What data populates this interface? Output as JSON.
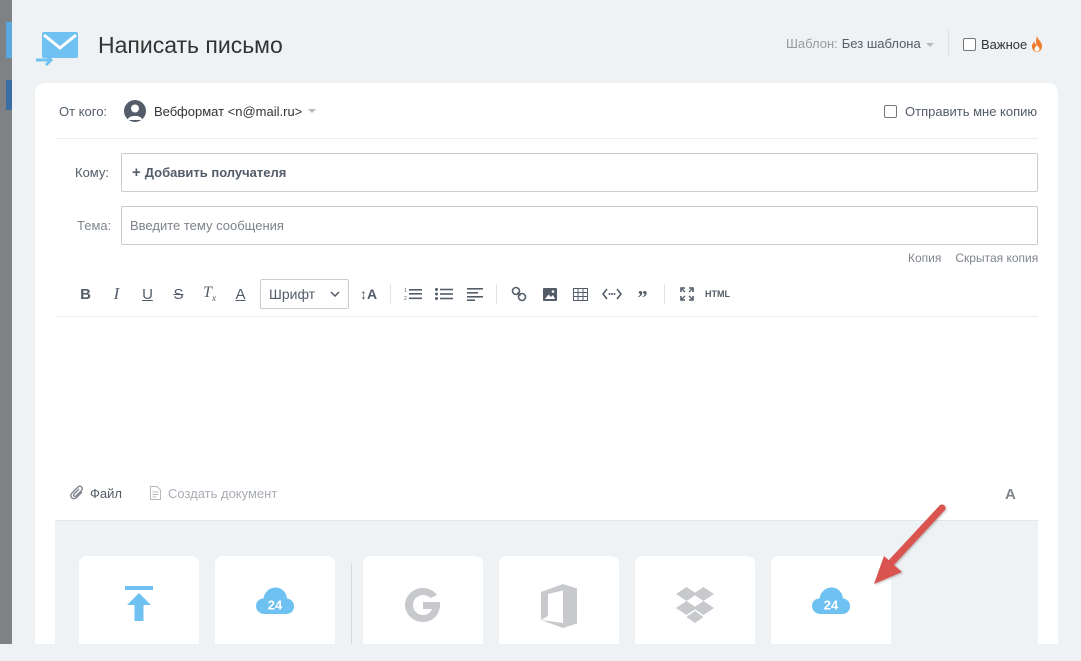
{
  "header": {
    "title": "Написать письмо",
    "template_label": "Шаблон:",
    "template_value": "Без шаблона",
    "important_label": "Важное"
  },
  "from": {
    "label": "От кого:",
    "value": "Вебформат <n@mail.ru>",
    "send_copy_label": "Отправить мне копию"
  },
  "to": {
    "label": "Кому:",
    "add_recipient": "Добавить получателя"
  },
  "subject": {
    "label": "Тема:",
    "placeholder": "Введите тему сообщения"
  },
  "cc": {
    "copy": "Копия",
    "bcc": "Скрытая копия"
  },
  "toolbar": {
    "font_select": "Шрифт",
    "html_label": "HTML"
  },
  "attachments": {
    "file_label": "Файл",
    "create_doc_label": "Создать документ",
    "font_toggle": "A"
  },
  "tiles": [
    {
      "icon": "upload-icon"
    },
    {
      "icon": "bitrix24-cloud-icon",
      "text": "24"
    },
    {
      "icon": "google-icon"
    },
    {
      "icon": "office-icon"
    },
    {
      "icon": "dropbox-icon"
    },
    {
      "icon": "bitrix24-cloud-icon",
      "text": "24"
    }
  ],
  "colors": {
    "accent_blue": "#6fc1f1",
    "arrow_red": "#d9534f",
    "text_gray": "#535c69"
  }
}
